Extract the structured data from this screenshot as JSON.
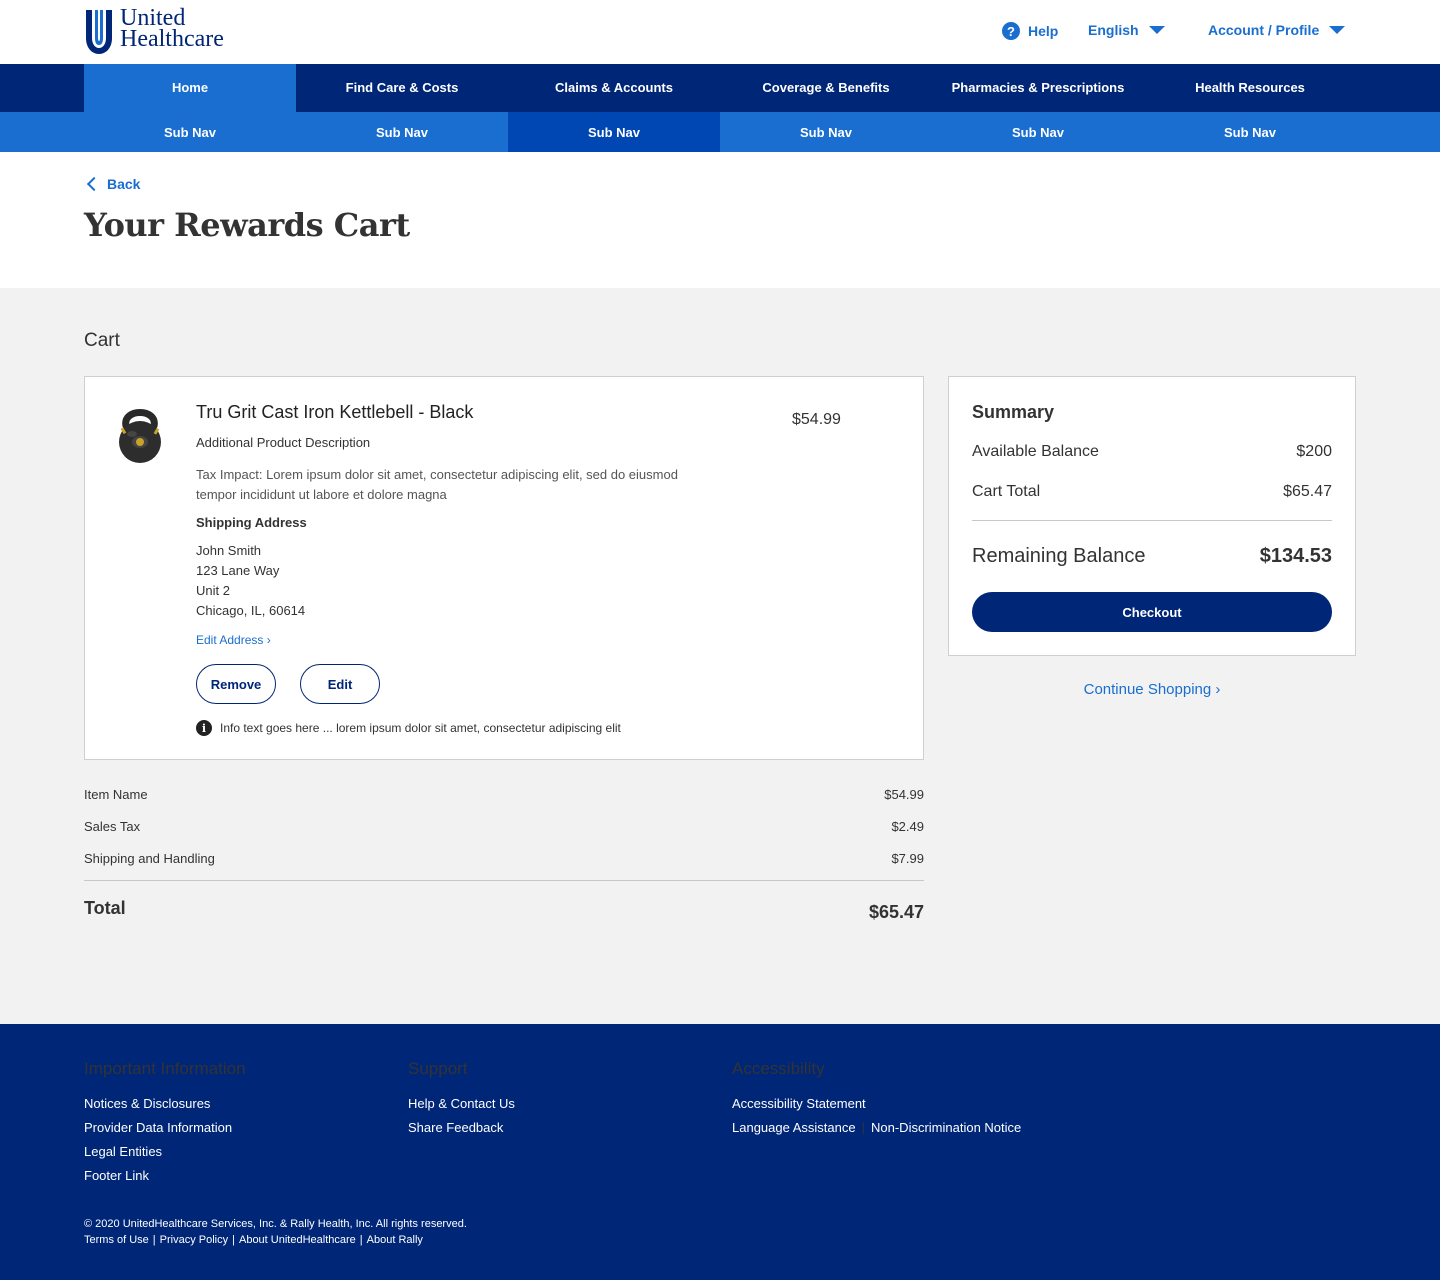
{
  "brand": {
    "line1": "United",
    "line2": "Healthcare",
    "colors": {
      "navy": "#002677",
      "blue": "#196ecf"
    }
  },
  "utility": {
    "help": "Help",
    "language": "English",
    "account": "Account / Profile"
  },
  "main_nav": [
    "Home",
    "Find Care & Costs",
    "Claims & Accounts",
    "Coverage & Benefits",
    "Pharmacies & Prescriptions",
    "Health Resources"
  ],
  "sub_nav": [
    "Sub Nav",
    "Sub Nav",
    "Sub Nav",
    "Sub Nav",
    "Sub Nav",
    "Sub Nav"
  ],
  "page": {
    "back": "Back",
    "title": "Your Rewards Cart"
  },
  "cart": {
    "label": "Cart",
    "item": {
      "name": "Tru Grit Cast Iron Kettlebell - Black",
      "price": "$54.99",
      "description": "Additional Product Description",
      "tax_impact": "Tax Impact: Lorem ipsum dolor sit amet, consectetur adipiscing elit, sed do eiusmod tempor incididunt ut labore et dolore magna",
      "shipping_heading": "Shipping Address",
      "address": [
        "John Smith",
        "123 Lane Way",
        "Unit 2",
        "Chicago, IL, 60614"
      ],
      "edit_address": "Edit Address ›",
      "remove": "Remove",
      "edit": "Edit",
      "info": "Info text goes here ... lorem ipsum dolor sit amet, consectetur adipiscing elit"
    },
    "lines": [
      {
        "label": "Item Name",
        "value": "$54.99"
      },
      {
        "label": "Sales Tax",
        "value": "$2.49"
      },
      {
        "label": "Shipping and Handling",
        "value": "$7.99"
      }
    ],
    "total_label": "Total",
    "total_value": "$65.47"
  },
  "summary": {
    "title": "Summary",
    "available_label": "Available Balance",
    "available_value": "$200",
    "cart_total_label": "Cart Total",
    "cart_total_value": "$65.47",
    "remaining_label": "Remaining Balance",
    "remaining_value": "$134.53",
    "checkout": "Checkout",
    "continue": "Continue Shopping ›"
  },
  "footer": {
    "col1": {
      "heading": "Important Information",
      "links": [
        "Notices & Disclosures",
        "Provider Data Information",
        "Legal Entities",
        "Footer Link"
      ]
    },
    "col2": {
      "heading": "Support",
      "links": [
        "Help & Contact Us",
        "Share Feedback"
      ]
    },
    "col3": {
      "heading": "Accessibility",
      "links": [
        "Accessibility Statement",
        "Language Assistance",
        "Non-Discrimination Notice"
      ]
    },
    "copyright": "© 2020 UnitedHealthcare Services, Inc. & Rally Health, Inc. All rights reserved.",
    "legal_links": [
      "Terms of Use",
      "Privacy Policy",
      "About UnitedHealthcare",
      "About Rally"
    ]
  }
}
